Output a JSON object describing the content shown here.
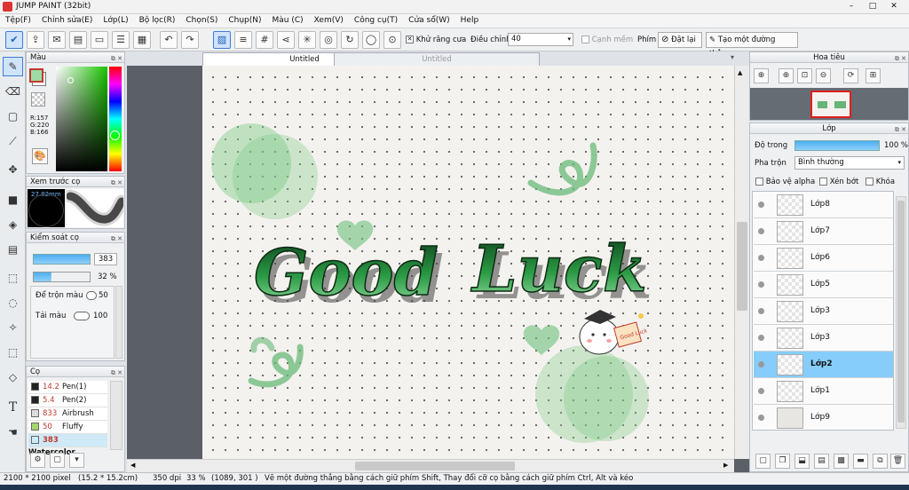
{
  "window": {
    "title": "JUMP PAINT (32bit)",
    "controls": [
      "–",
      "□",
      "✕"
    ]
  },
  "menu": [
    "Tệp(F)",
    "Chỉnh sửa(E)",
    "Lớp(L)",
    "Bộ lọc(R)",
    "Chọn(S)",
    "Chụp(N)",
    "Màu (C)",
    "Xem(V)",
    "Công cụ(T)",
    "Cửa sổ(W)",
    "Help"
  ],
  "toolbar": {
    "antialias_label": "Khử răng cưa",
    "adjust_label": "Điều chỉnh",
    "adjust_value": "40",
    "edge_label": "Cạnh mềm",
    "key_label": "Phím",
    "reset_label": "Đặt lại",
    "straight_label": "Tạo một đường thẳng"
  },
  "panels": {
    "color": {
      "title": "Màu",
      "r": "R:157",
      "g": "G:220",
      "b": "B:166"
    },
    "preview": {
      "title": "Xem trước cọ",
      "size": "27.82mm"
    },
    "brush_control": {
      "title": "Kiểm soát cọ",
      "size_value": "383",
      "opacity_value": "32 %",
      "blend_label": "Để trộn màu",
      "blend_value": "50",
      "amount_label": "Tải màu",
      "amount_value": "100"
    },
    "brushes": {
      "title": "Cọ",
      "items": [
        {
          "size": "14.2",
          "name": "Pen(1)",
          "color": "#222222"
        },
        {
          "size": "5.4",
          "name": "Pen(2)",
          "color": "#222222"
        },
        {
          "size": "833",
          "name": "Airbrush",
          "color": "#dddddd"
        },
        {
          "size": "50",
          "name": "Fluffy Water",
          "color": "#a5d86a"
        },
        {
          "size": "383",
          "name": "Watercolor",
          "color": "#cfe9f7"
        }
      ]
    },
    "navigator": {
      "title": "Hoa tiêu"
    },
    "layer": {
      "title": "Lớp",
      "opacity_label": "Độ trong",
      "opacity_value": "100 %",
      "blend_label": "Pha trộn",
      "blend_value": "Bình thường",
      "protect_alpha": "Bảo vệ alpha",
      "clipping": "Xén bớt",
      "lock": "Khóa",
      "layers": [
        "Lớp8",
        "Lớp7",
        "Lớp6",
        "Lớp5",
        "Lớp3",
        "Lớp3",
        "Lớp2",
        "Lớp1",
        "Lớp9"
      ],
      "selected_index": 6
    }
  },
  "tabs": [
    "Untitled",
    "Untitled"
  ],
  "artwork": {
    "word1": "Good",
    "word2": "Luck",
    "tag": "Good Luck"
  },
  "status": {
    "size": "2100 * 2100 pixel",
    "cm": "(15.2 * 15.2cm)",
    "dpi": "350 dpi",
    "zoom": "33 %",
    "coords": "(1089, 301 )",
    "hint": "Vẽ một đường thẳng bằng cách giữ phím Shift, Thay đổi cỡ cọ bằng cách giữ phím Ctrl, Alt và kéo"
  }
}
